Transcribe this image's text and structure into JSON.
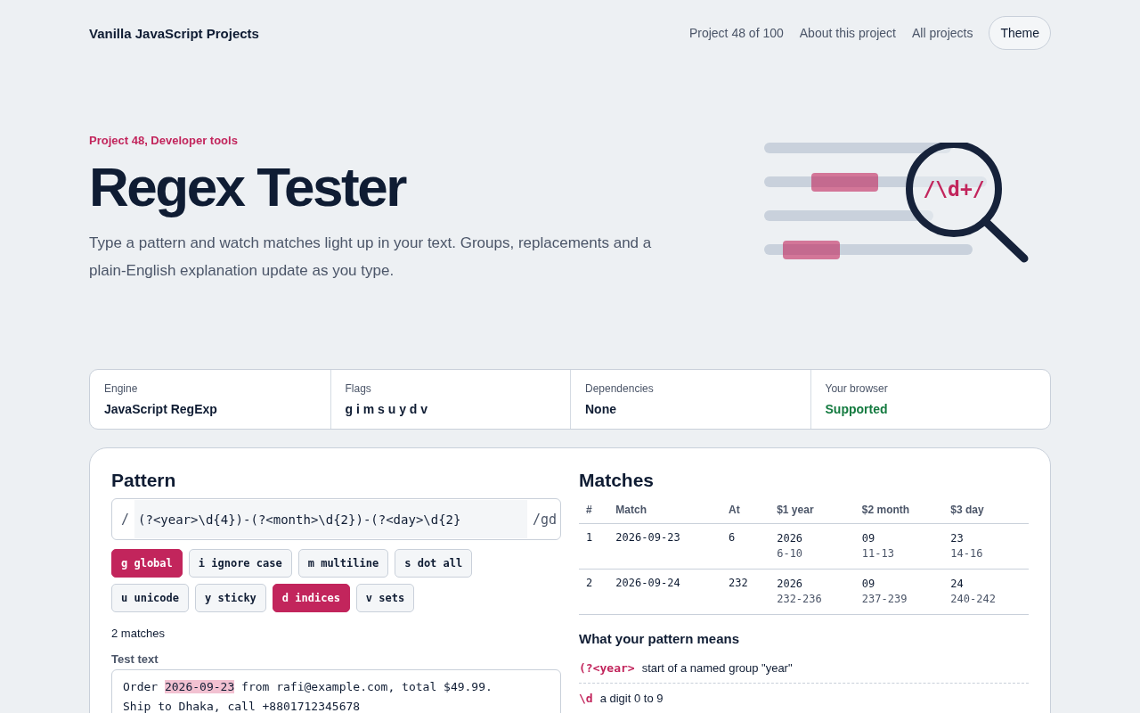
{
  "header": {
    "brand": "Vanilla JavaScript Projects",
    "nav": [
      {
        "label": "Project 48 of 100",
        "kind": "text"
      },
      {
        "label": "About this project",
        "kind": "link"
      },
      {
        "label": "All projects",
        "kind": "link"
      },
      {
        "label": "Theme",
        "kind": "button"
      }
    ]
  },
  "hero": {
    "eyebrow": "Project 48, Developer tools",
    "title": "Regex Tester",
    "lead": "Type a pattern and watch matches light up in your text. Groups, replacements and a plain-English explanation update as you type.",
    "illustration_text": "/\\d+/"
  },
  "facts": [
    {
      "label": "Engine",
      "value": "JavaScript RegExp",
      "kind": "plain"
    },
    {
      "label": "Flags",
      "value": "g i m s u y d v",
      "kind": "plain"
    },
    {
      "label": "Dependencies",
      "value": "None",
      "kind": "plain"
    },
    {
      "label": "Your browser",
      "value": "Supported",
      "kind": "good"
    }
  ],
  "pattern": {
    "title": "Pattern",
    "open": "/",
    "value": "(?<year>\\d{4})-(?<month>\\d{2})-(?<day>\\d{2}",
    "close": "/gd",
    "flags": [
      {
        "label": "g global",
        "selected": true
      },
      {
        "label": "i ignore case",
        "selected": false
      },
      {
        "label": "m multiline",
        "selected": false
      },
      {
        "label": "s dot all",
        "selected": false
      },
      {
        "label": "u unicode",
        "selected": false
      },
      {
        "label": "y sticky",
        "selected": false
      },
      {
        "label": "d indices",
        "selected": true
      },
      {
        "label": "v sets",
        "selected": false
      }
    ],
    "count": "2 matches",
    "test_label": "Test text",
    "test_lines": [
      [
        {
          "text": "Order ",
          "highlight": false
        },
        {
          "text": "2026-09-23",
          "highlight": true
        },
        {
          "text": " from rafi@example.com, total $49.99.",
          "highlight": false
        }
      ],
      [
        {
          "text": "Ship to Dhaka, call +8801712345678",
          "highlight": false
        }
      ]
    ]
  },
  "matches": {
    "title": "Matches",
    "columns": [
      "#",
      "Match",
      "At",
      "$1 year",
      "$2 month",
      "$3 day"
    ],
    "rows": [
      {
        "n": "1",
        "match": "2026-09-23",
        "at": "6",
        "groups": [
          {
            "value": "2026",
            "span": "6-10"
          },
          {
            "value": "09",
            "span": "11-13"
          },
          {
            "value": "23",
            "span": "14-16"
          }
        ]
      },
      {
        "n": "2",
        "match": "2026-09-24",
        "at": "232",
        "groups": [
          {
            "value": "2026",
            "span": "232-236"
          },
          {
            "value": "09",
            "span": "237-239"
          },
          {
            "value": "24",
            "span": "240-242"
          }
        ]
      }
    ],
    "explain_title": "What your pattern means",
    "explain": [
      {
        "token": "(?<year>",
        "text": "start of a named group \"year\""
      },
      {
        "token": "\\d",
        "text": "a digit 0 to 9"
      }
    ]
  }
}
